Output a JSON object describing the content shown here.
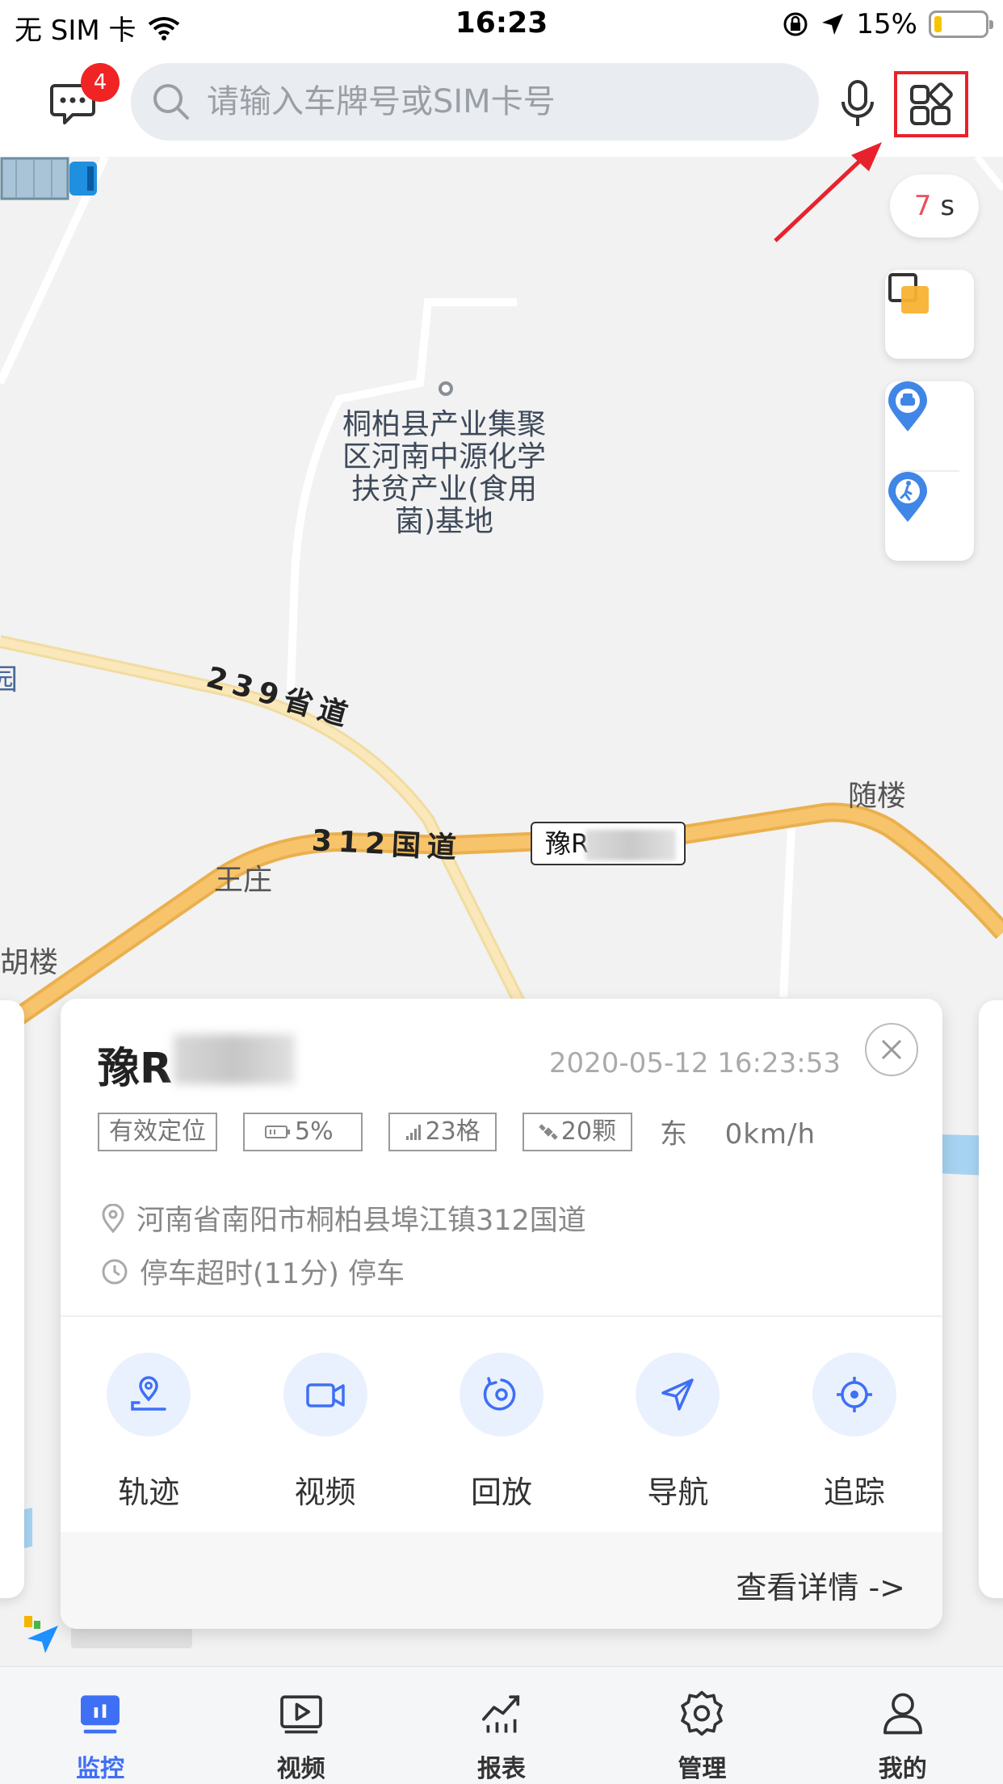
{
  "status_bar": {
    "carrier": "无 SIM 卡",
    "time": "16:23",
    "battery_percent": "15%",
    "battery_level": 0.15
  },
  "header": {
    "message_badge": "4",
    "search_placeholder": "请输入车牌号或SIM卡号"
  },
  "map": {
    "poi_label": "桐柏县产业集聚区河南中源化学扶贫产业(食用菌)基地",
    "road_239": "239省道",
    "road_312": "312国道",
    "place_suilou": "随楼",
    "place_wangzhuang": "王庄",
    "place_hulou": "胡楼",
    "place_edge": "园",
    "vehicle_plate_label": "豫R",
    "refresh_timer_value": "7",
    "refresh_timer_unit": "s"
  },
  "vehicle_card": {
    "plate": "豫R",
    "timestamp": "2020-05-12 16:23:53",
    "tags": [
      "有效定位",
      "5%",
      "23格",
      "20颗"
    ],
    "direction": "东",
    "speed": "0km/h",
    "address": "河南省南阳市桐柏县埠江镇312国道",
    "status": "停车超时(11分) 停车",
    "actions": [
      {
        "label": "轨迹",
        "icon": "track-icon"
      },
      {
        "label": "视频",
        "icon": "video-camera-icon"
      },
      {
        "label": "回放",
        "icon": "replay-icon"
      },
      {
        "label": "导航",
        "icon": "navigation-icon"
      },
      {
        "label": "追踪",
        "icon": "tracking-icon"
      }
    ],
    "detail_link": "查看详情 ->"
  },
  "tabbar": {
    "tabs": [
      {
        "label": "监控",
        "icon": "monitor-icon",
        "active": true
      },
      {
        "label": "视频",
        "icon": "video-play-icon",
        "active": false
      },
      {
        "label": "报表",
        "icon": "report-chart-icon",
        "active": false
      },
      {
        "label": "管理",
        "icon": "settings-gear-icon",
        "active": false
      },
      {
        "label": "我的",
        "icon": "user-icon",
        "active": false
      }
    ]
  },
  "colors": {
    "accent": "#3e6ff5",
    "badge_red": "#f02424",
    "highlight_box": "#e8222c",
    "road_orange": "#f5c064"
  }
}
